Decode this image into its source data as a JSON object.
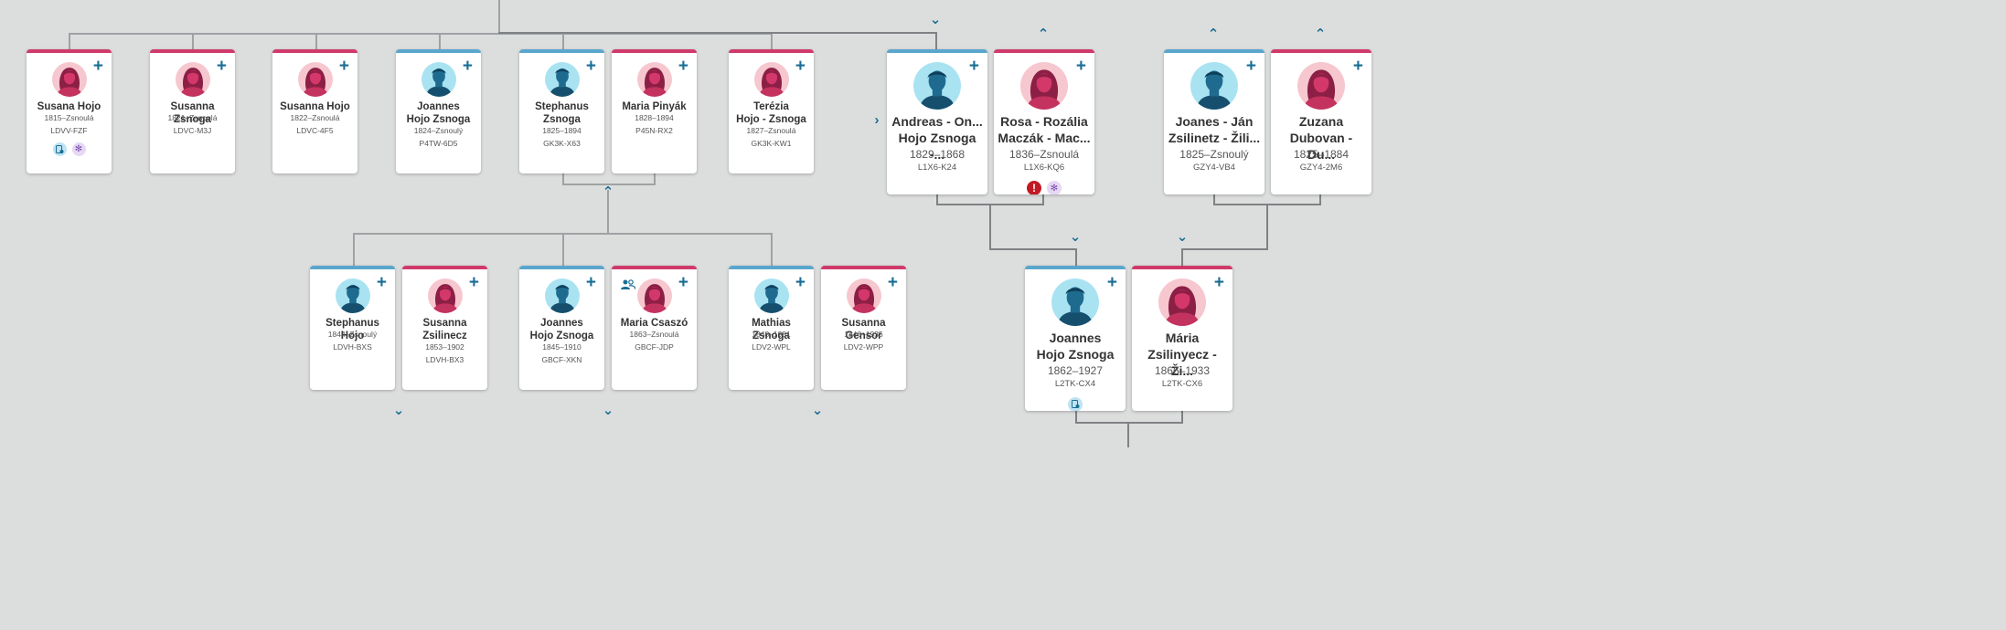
{
  "colors": {
    "background": "#dcdddd",
    "male_accent": "#5aa6cd",
    "female_accent": "#cf3a6a",
    "link": "#1a6d94",
    "record_badge": "#bfe3f3",
    "temple_badge": "#e6d8f3",
    "error_badge": "#c21a24"
  },
  "icons": {
    "add": "+",
    "chevron_down": "⌄",
    "chevron_up": "⌃",
    "chevron_right": "›",
    "record_hint": "record-hint-icon",
    "temple": "temple-icon",
    "data_problem": "!",
    "couple": "couple-icon"
  },
  "people": [
    {
      "id": "susana-hojo",
      "gender": "f",
      "name": "Susana Hojo",
      "dates": "1815–Zsnoulá",
      "pid": "LDVV-FZF",
      "badges": [
        "record",
        "temple"
      ]
    },
    {
      "id": "susanna-zsnoga",
      "gender": "f",
      "name": "Susanna Zsnoga",
      "dates": "1821–Zsnoulá",
      "pid": "LDVC-M3J",
      "badges": []
    },
    {
      "id": "susanna-hojo",
      "gender": "f",
      "name": "Susanna Hojo",
      "dates": "1822–Zsnoulá",
      "pid": "LDVC-4F5",
      "badges": []
    },
    {
      "id": "joannes-hojo-zsnoga-1824",
      "gender": "m",
      "name": "Joannes Hojo Zsnoga",
      "dates": "1824–Zsnoulý",
      "pid": "P4TW-6D5",
      "badges": []
    },
    {
      "id": "stephanus-zsnoga",
      "gender": "m",
      "name": "Stephanus Zsnoga",
      "dates": "1825–1894",
      "pid": "GK3K-X63",
      "badges": []
    },
    {
      "id": "maria-pinyak",
      "gender": "f",
      "name": "Maria Pinyák",
      "dates": "1828–1894",
      "pid": "P45N-RX2",
      "badges": []
    },
    {
      "id": "terezia-hojo-zsnoga",
      "gender": "f",
      "name": "Terézia Hojo - Zsnoga",
      "dates": "1827–Zsnoulá",
      "pid": "GK3K-KW1",
      "badges": []
    },
    {
      "id": "andreas",
      "gender": "m",
      "name": "Andreas - On... Hojo Zsnoga -...",
      "dates": "1829–1868",
      "pid": "L1X6-K24",
      "badges": []
    },
    {
      "id": "rosa",
      "gender": "f",
      "name": "Rosa - Rozália Maczák - Mac...",
      "dates": "1836–Zsnoulá",
      "pid": "L1X6-KQ6",
      "badges": [
        "error",
        "temple"
      ]
    },
    {
      "id": "joanes-jan",
      "gender": "m",
      "name": "Joanes - Ján Zsilinetz - Žili...",
      "dates": "1825–Zsnoulý",
      "pid": "GZY4-VB4",
      "badges": []
    },
    {
      "id": "zuzana",
      "gender": "f",
      "name": "Zuzana Dubovan - Du...",
      "dates": "1825–1884",
      "pid": "GZY4-2M6",
      "badges": []
    },
    {
      "id": "stephanus-hojo",
      "gender": "m",
      "name": "Stephanus Hojo",
      "dates": "1844–Zsnoulý",
      "pid": "LDVH-BXS",
      "badges": []
    },
    {
      "id": "susanna-zsilinecz",
      "gender": "f",
      "name": "Susanna Zsilinecz",
      "dates": "1853–1902",
      "pid": "LDVH-BX3",
      "badges": []
    },
    {
      "id": "joannes-hojo-zsnoga-1845",
      "gender": "m",
      "name": "Joannes Hojo Zsnoga",
      "dates": "1845–1910",
      "pid": "GBCF-XKN",
      "badges": []
    },
    {
      "id": "maria-csaszo",
      "gender": "f",
      "name": "Maria Csaszó",
      "dates": "1863–Zsnoulá",
      "pid": "GBCF-JDP",
      "badges": [],
      "couple_icon": true
    },
    {
      "id": "mathias-zsnoga",
      "gender": "m",
      "name": "Mathias Zsnoga",
      "dates": "1848–1931",
      "pid": "LDV2-WPL",
      "badges": []
    },
    {
      "id": "susanna-gensor",
      "gender": "f",
      "name": "Susanna Gensor",
      "dates": "1846–1935",
      "pid": "LDV2-WPP",
      "badges": []
    },
    {
      "id": "joannes-hojo-zsnoga-1862",
      "gender": "m",
      "name": "Joannes Hojo Zsnoga",
      "dates": "1862–1927",
      "pid": "L2TK-CX4",
      "badges": [
        "record"
      ]
    },
    {
      "id": "maria-zsilinyecz",
      "gender": "f",
      "name": "Mária Zsilinyecz - Ži...",
      "dates": "1866–1933",
      "pid": "L2TK-CX6",
      "badges": []
    }
  ]
}
